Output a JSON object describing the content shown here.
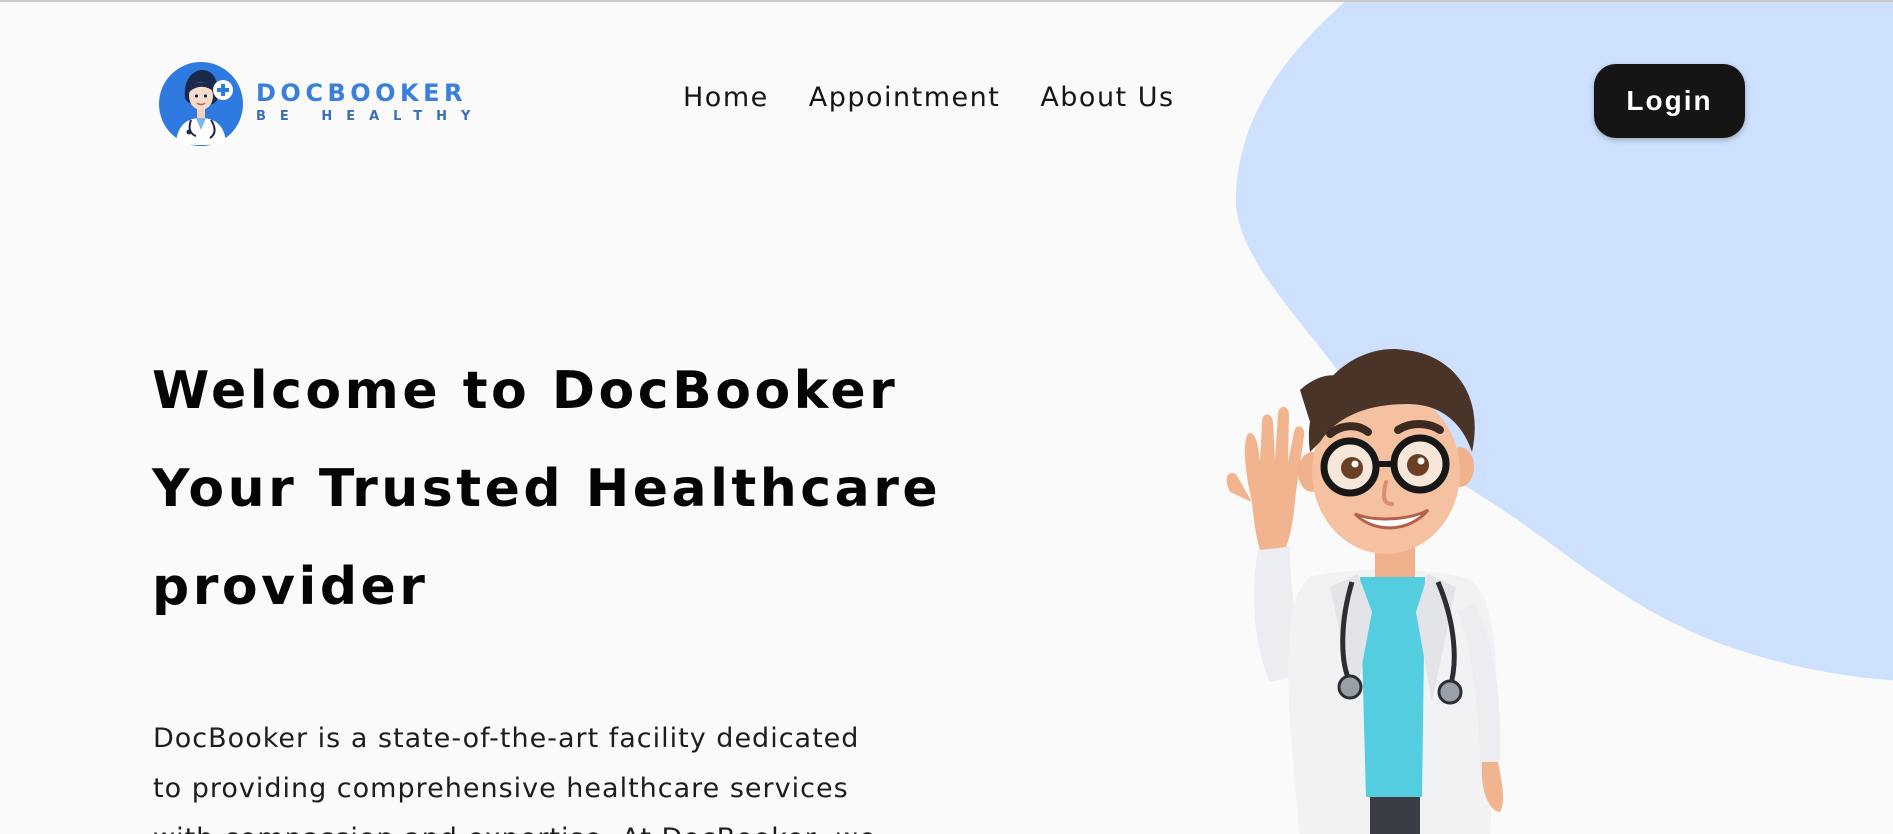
{
  "colors": {
    "background": "#fafafa",
    "blob": "#cde0fd",
    "brand_blue": "#3a7fd9",
    "login_bg": "#151515",
    "login_text": "#ffffff"
  },
  "header": {
    "logo": {
      "name": "DOCBOOKER",
      "tagline": "BE HEALTHY",
      "icon": "doctor-avatar-icon"
    },
    "nav": [
      {
        "label": "Home"
      },
      {
        "label": "Appointment"
      },
      {
        "label": "About Us"
      }
    ],
    "login_label": "Login"
  },
  "hero": {
    "title_lines": [
      "Welcome to DocBooker",
      "Your Trusted Healthcare",
      "provider"
    ],
    "description_lines": [
      "DocBooker is a state-of-the-art facility dedicated",
      "to providing comprehensive healthcare services",
      "with compassion and expertise. At DocBooker, we"
    ],
    "illustration": "waving-doctor-illustration"
  }
}
